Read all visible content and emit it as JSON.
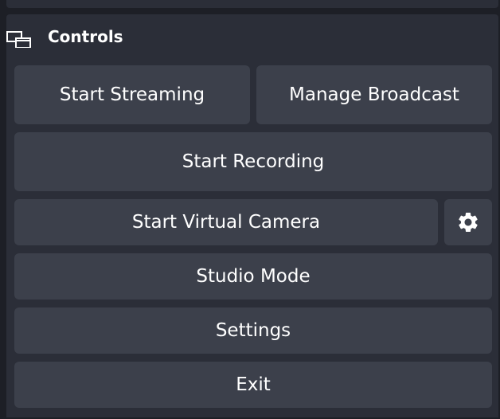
{
  "dock": {
    "title": "Controls",
    "icon": "dock-window-icon"
  },
  "buttons": {
    "start_streaming": "Start Streaming",
    "manage_broadcast": "Manage Broadcast",
    "start_recording": "Start Recording",
    "start_virtual_camera": "Start Virtual Camera",
    "virtual_camera_settings_icon": "gear-icon",
    "studio_mode": "Studio Mode",
    "settings": "Settings",
    "exit": "Exit"
  },
  "colors": {
    "background": "#1d1f26",
    "panel": "#2b2e38",
    "button": "#3c404b",
    "text": "#ffffff"
  }
}
